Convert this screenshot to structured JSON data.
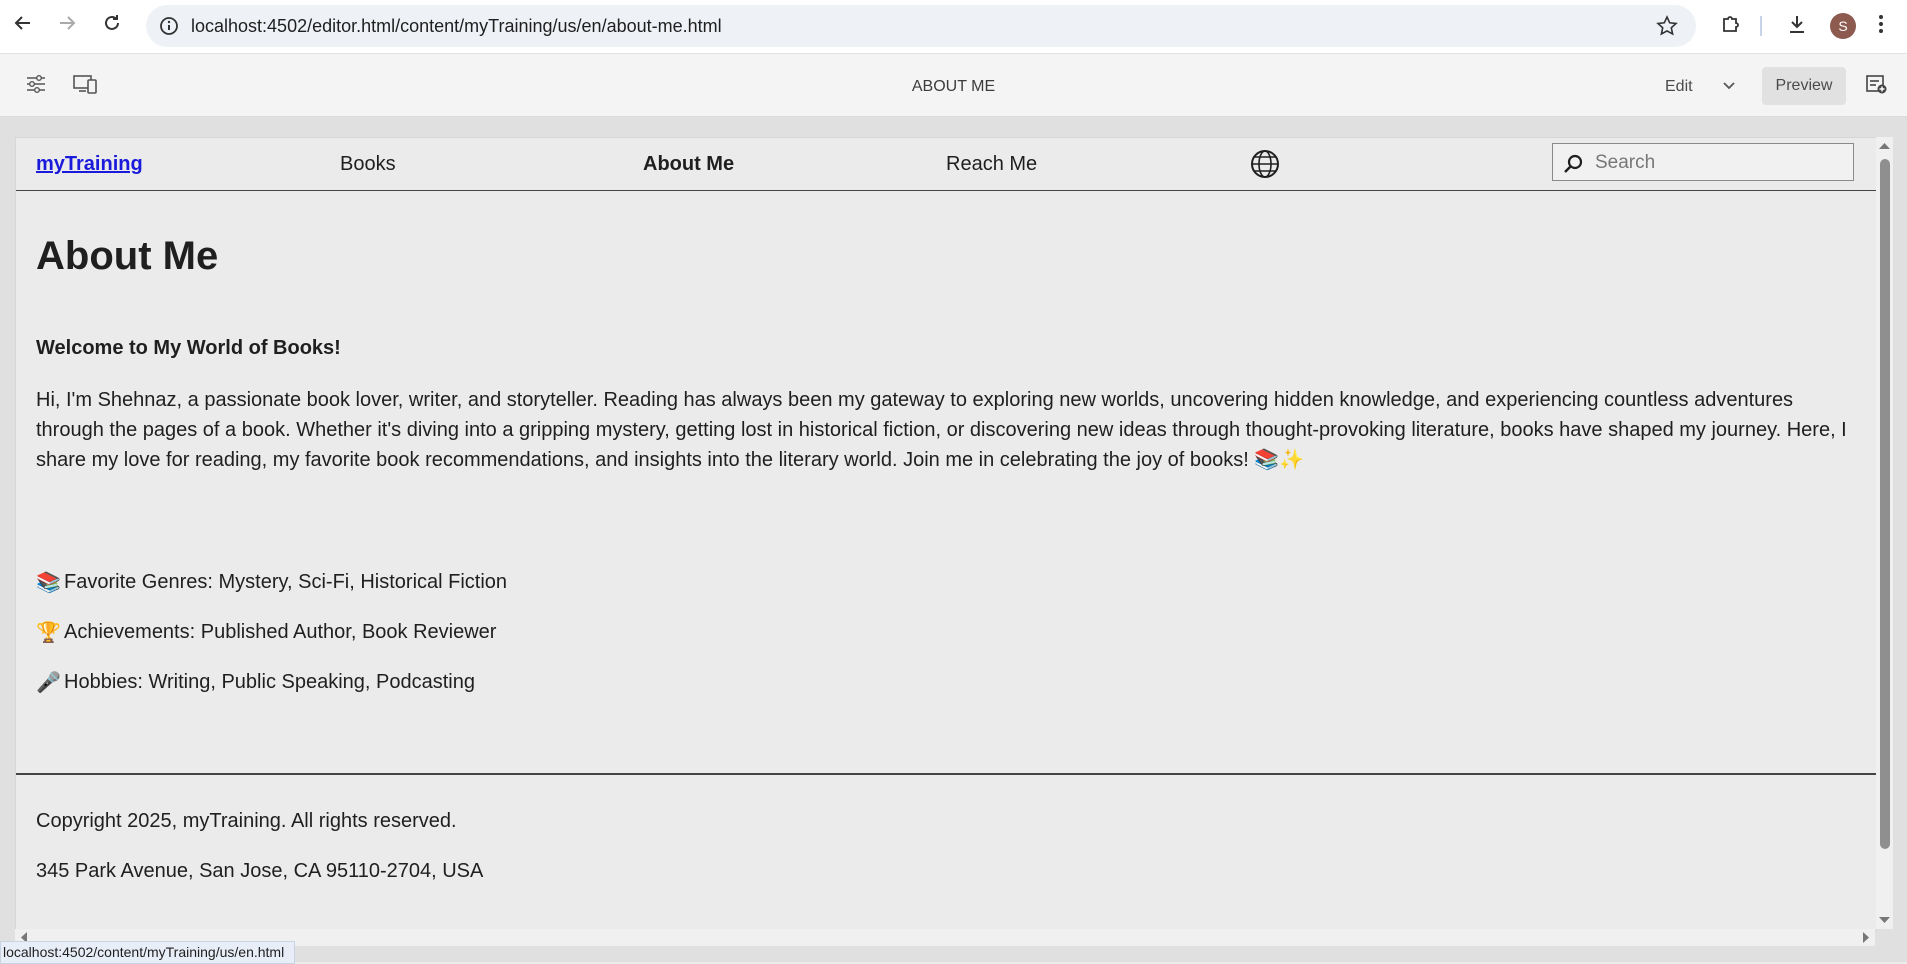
{
  "browser": {
    "url": "localhost:4502/editor.html/content/myTraining/us/en/about-me.html",
    "avatar_initial": "S",
    "status_url": "localhost:4502/content/myTraining/us/en.html"
  },
  "editor": {
    "page_title": "ABOUT ME",
    "mode_label": "Edit",
    "preview_label": "Preview"
  },
  "site": {
    "brand": "myTraining",
    "nav": [
      "Books",
      "About Me",
      "Reach Me"
    ],
    "search_placeholder": "Search"
  },
  "content": {
    "title": "About Me",
    "welcome": "Welcome to My World of Books!",
    "intro": "Hi, I'm Shehnaz, a passionate book lover, writer, and storyteller. Reading has always been my gateway to exploring new worlds, uncovering hidden knowledge, and experiencing countless adventures through the pages of a book. Whether it's diving into a gripping mystery, getting lost in historical fiction, or discovering new ideas through thought-provoking literature, books have shaped my journey. Here, I share my love for reading, my favorite book recommendations, and insights into the literary world. Join me in celebrating the joy of books! 📚✨",
    "facts": [
      {
        "emoji": "📚",
        "text": "Favorite Genres: Mystery, Sci-Fi, Historical Fiction"
      },
      {
        "emoji": "🏆",
        "text": "Achievements: Published Author, Book Reviewer"
      },
      {
        "emoji": "🎤",
        "text": "Hobbies: Writing, Public Speaking, Podcasting"
      }
    ]
  },
  "footer": {
    "copyright": "Copyright 2025, myTraining. All rights reserved.",
    "address": "345 Park Avenue, San Jose, CA 95110-2704, USA"
  },
  "colors": {
    "brand_link": "#1a1adb",
    "page_bg": "#ebebeb"
  }
}
